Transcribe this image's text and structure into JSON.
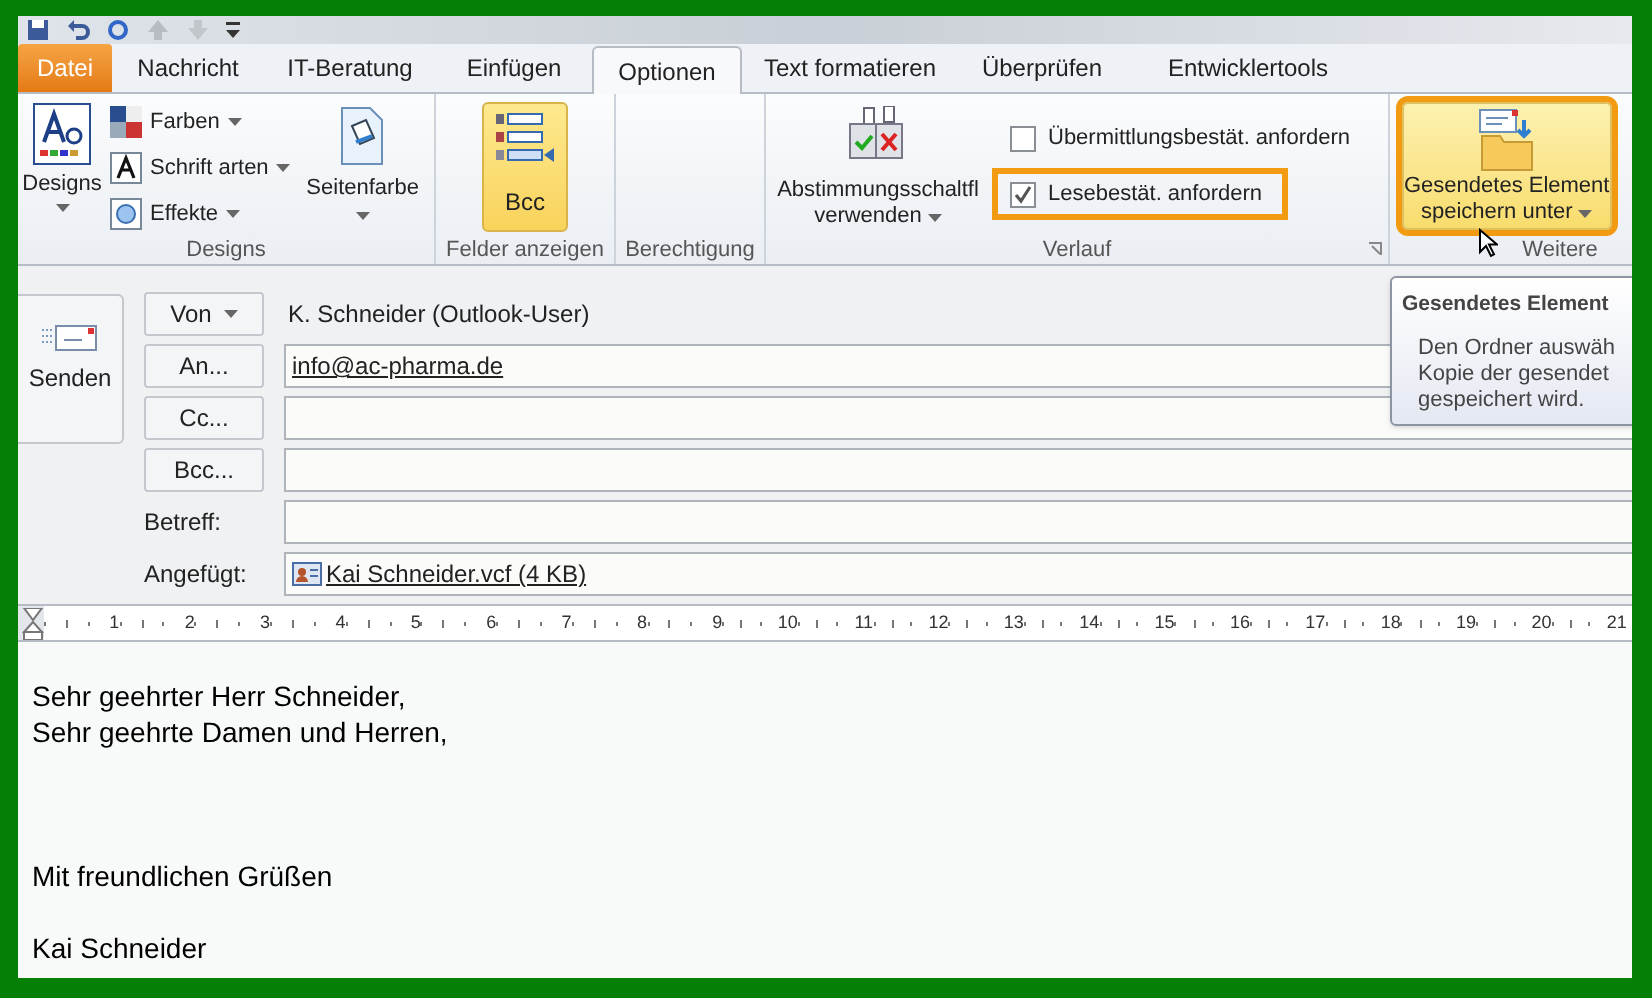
{
  "tabs": [
    {
      "label": "Datei",
      "kind": "file",
      "selected": false
    },
    {
      "label": "Nachricht",
      "kind": "tab",
      "selected": false
    },
    {
      "label": "IT-Beratung",
      "kind": "tab",
      "selected": false
    },
    {
      "label": "Einfügen",
      "kind": "tab",
      "selected": false
    },
    {
      "label": "Optionen",
      "kind": "tab",
      "selected": true
    },
    {
      "label": "Text formatieren",
      "kind": "tab",
      "selected": false
    },
    {
      "label": "Überprüfen",
      "kind": "tab",
      "selected": false
    },
    {
      "label": "Entwicklertools",
      "kind": "tab",
      "selected": false
    }
  ],
  "ribbon_groups": [
    {
      "kind": "designs",
      "label": "Designs",
      "designs_button": {
        "label": "Designs"
      },
      "small_buttons": [
        {
          "label": "Farben"
        },
        {
          "label": "Schrift arten"
        },
        {
          "label": "Effekte"
        }
      ],
      "page_color_button": {
        "label": "Seitenfarbe"
      }
    },
    {
      "kind": "fields",
      "label": "Felder anzeigen",
      "bcc_button": {
        "label": "Bcc",
        "selected": true
      }
    },
    {
      "kind": "permission",
      "label": "Berechtigung"
    },
    {
      "kind": "tracking",
      "label": "Verlauf",
      "vote_button": {
        "label_lines": [
          "Abstimmungsschaltfl",
          "verwenden"
        ]
      },
      "checkboxes": [
        {
          "label": "Übermittlungsbestät. anfordern",
          "checked": false,
          "highlighted": false
        },
        {
          "label": "Lesebestät. anfordern",
          "checked": true,
          "highlighted": true
        }
      ]
    },
    {
      "kind": "more",
      "label": "Weitere",
      "save_button": {
        "label_lines": [
          "Gesendetes Element",
          "speichern unter"
        ],
        "highlighted": true
      }
    }
  ],
  "send_button": {
    "label": "Senden"
  },
  "header_fields": [
    {
      "kind": "from",
      "button": "Von",
      "value": "K. Schneider (Outlook-User)"
    },
    {
      "kind": "address",
      "button": "An...",
      "value": "info@ac-pharma.de"
    },
    {
      "kind": "address",
      "button": "Cc..."
    },
    {
      "kind": "address",
      "button": "Bcc..."
    },
    {
      "kind": "subject",
      "label": "Betreff:"
    },
    {
      "kind": "attachment",
      "label": "Angefügt:",
      "value": "Kai Schneider.vcf (4 KB)"
    }
  ],
  "tooltip": {
    "title": "Gesendetes Element",
    "lines": [
      "Den Ordner auswäh",
      "Kopie der gesendet",
      "gespeichert wird."
    ]
  },
  "ruler": {
    "marks": [
      "1",
      "2",
      "3",
      "4",
      "5",
      "6",
      "7",
      "8",
      "9",
      "10",
      "11",
      "12",
      "13",
      "14",
      "15",
      "16",
      "17",
      "18",
      "19",
      "20",
      "21"
    ]
  },
  "body": [
    {
      "kind": "salutation",
      "text": "Sehr geehrter Herr Schneider,"
    },
    {
      "kind": "salutation",
      "text": "Sehr geehrte Damen und Herren,"
    },
    {
      "kind": "closing",
      "text": "Mit freundlichen Grüßen"
    },
    {
      "kind": "signature",
      "text": "Kai Schneider"
    }
  ]
}
